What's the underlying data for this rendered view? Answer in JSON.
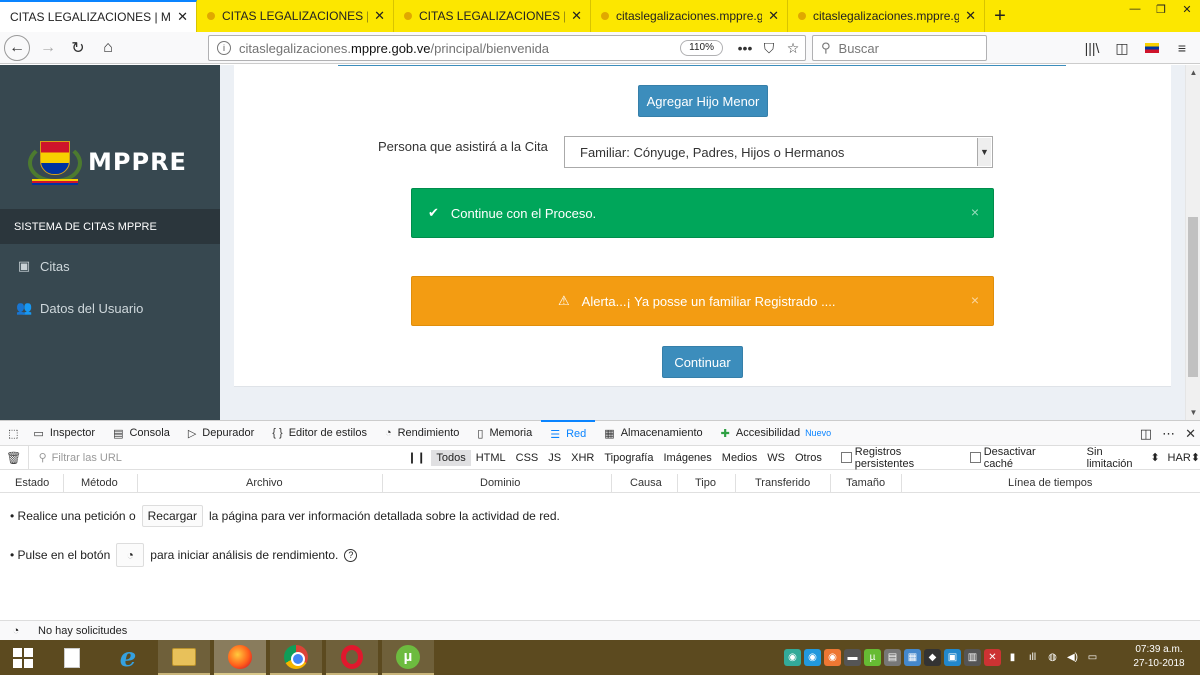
{
  "browser": {
    "tabs": [
      {
        "title": "CITAS LEGALIZACIONES | MPPRE",
        "active": true
      },
      {
        "title": "CITAS LEGALIZACIONES | MPPRE",
        "active": false
      },
      {
        "title": "CITAS LEGALIZACIONES | MPPRE",
        "active": false
      },
      {
        "title": "citaslegalizaciones.mppre.gob.ve",
        "active": false
      },
      {
        "title": "citaslegalizaciones.mppre.gob.ve",
        "active": false
      }
    ],
    "url_prefix": "citaslegalizaciones.",
    "url_domain": "mppre.gob.ve",
    "url_path": "/principal/bienvenida",
    "zoom": "110%",
    "search_placeholder": "Buscar"
  },
  "sidebar": {
    "brand": "MPPRE",
    "header": "SISTEMA DE CITAS MPPRE",
    "items": [
      {
        "label": "Citas",
        "icon": "calendar-plus-icon"
      },
      {
        "label": "Datos del Usuario",
        "icon": "users-icon"
      }
    ]
  },
  "main": {
    "add_child_button": "Agregar Hijo Menor",
    "persona_label": "Persona que asistirá a la Cita",
    "persona_selected": "Familiar: Cónyuge, Padres, Hijos o Hermanos",
    "success_message": "Continue con el Proceso.",
    "warning_message": "Alerta...¡ Ya posse un familiar Registrado ....",
    "continue_button": "Continuar",
    "colors": {
      "primary": "#3c8dbc",
      "success": "#00a65a",
      "warning": "#f39c12",
      "sidebar": "#374850"
    }
  },
  "devtools": {
    "tabs": [
      {
        "label": "Inspector",
        "icon": "inspector-icon"
      },
      {
        "label": "Consola",
        "icon": "console-icon"
      },
      {
        "label": "Depurador",
        "icon": "debugger-icon"
      },
      {
        "label": "Editor de estilos",
        "icon": "style-editor-icon"
      },
      {
        "label": "Rendimiento",
        "icon": "performance-icon"
      },
      {
        "label": "Memoria",
        "icon": "memory-icon"
      },
      {
        "label": "Red",
        "icon": "network-icon"
      },
      {
        "label": "Almacenamiento",
        "icon": "storage-icon"
      },
      {
        "label": "Accesibilidad",
        "icon": "accessibility-icon"
      }
    ],
    "new_badge": "Nuevo",
    "filter_placeholder": "Filtrar las URL",
    "filter_types": [
      "Todos",
      "HTML",
      "CSS",
      "JS",
      "XHR",
      "Tipografía",
      "Imágenes",
      "Medios",
      "WS",
      "Otros"
    ],
    "persist_logs": "Registros persistentes",
    "disable_cache": "Desactivar caché",
    "throttling": "Sin limitación",
    "har": "HAR",
    "columns": [
      "Estado",
      "Método",
      "Archivo",
      "Dominio",
      "Causa",
      "Tipo",
      "Transferido",
      "Tamaño",
      "Línea de tiempos"
    ],
    "hint1_pre": "• Realice una petición o",
    "hint1_btn": "Recargar",
    "hint1_post": "la página para ver información detallada sobre la actividad de red.",
    "hint2_pre": "• Pulse en el botón",
    "hint2_post": "para iniciar análisis de rendimiento.",
    "status": "No hay solicitudes"
  },
  "taskbar": {
    "time": "07:39 a.m.",
    "date": "27-10-2018"
  }
}
